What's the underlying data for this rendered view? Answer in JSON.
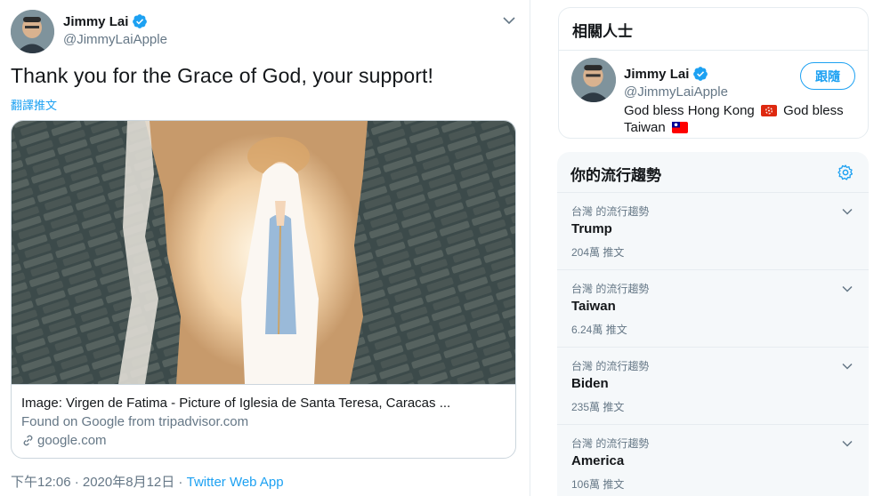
{
  "tweet": {
    "author_name": "Jimmy Lai",
    "author_handle": "@JimmyLaiApple",
    "text": "Thank you for the Grace of God, your support!",
    "translate_label": "翻譯推文",
    "timestamp": "下午12:06 · 2020年8月12日",
    "separator": " · ",
    "source_app": "Twitter Web App"
  },
  "card": {
    "title": "Image: Virgen de Fatima - Picture of Iglesia de Santa Teresa, Caracas ...",
    "description": "Found on Google from tripadvisor.com",
    "domain": "google.com"
  },
  "related_people": {
    "title": "相關人士",
    "person": {
      "name": "Jimmy Lai",
      "handle": "@JimmyLaiApple",
      "bio_part1": "God bless Hong Kong",
      "bio_part2": "God bless Taiwan",
      "follow_label": "跟隨"
    }
  },
  "trends": {
    "title": "你的流行趨勢",
    "items": [
      {
        "context": "台灣 的流行趨勢",
        "name": "Trump",
        "count": "204萬 推文"
      },
      {
        "context": "台灣 的流行趨勢",
        "name": "Taiwan",
        "count": "6.24萬 推文"
      },
      {
        "context": "台灣 的流行趨勢",
        "name": "Biden",
        "count": "235萬 推文"
      },
      {
        "context": "台灣 的流行趨勢",
        "name": "America",
        "count": "106萬 推文"
      }
    ]
  },
  "colors": {
    "accent": "#1da1f2",
    "text": "#14171a",
    "secondary": "#657786",
    "border": "#e6ecf0"
  }
}
